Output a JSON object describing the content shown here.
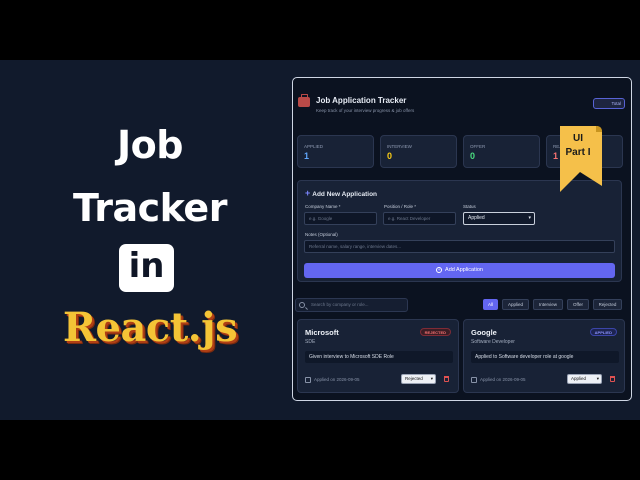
{
  "thumbnail": {
    "line1": "Job",
    "line2": "Tracker",
    "line3": "in",
    "line4": "React.js"
  },
  "ribbon": {
    "line1": "UI",
    "line2": "Part I"
  },
  "app": {
    "title": "Job Application Tracker",
    "subtitle": "Keep track of your interview progress & job offers",
    "total_label": "Total",
    "stats": [
      {
        "label": "APPLIED",
        "value": "1",
        "color": "#60a5fa"
      },
      {
        "label": "INTERVIEW",
        "value": "0",
        "color": "#facc15"
      },
      {
        "label": "OFFER",
        "value": "0",
        "color": "#4ade80"
      },
      {
        "label": "REJECTED",
        "value": "1",
        "color": "#f87171"
      }
    ],
    "form": {
      "heading": "Add New Application",
      "company_label": "Company Name *",
      "company_placeholder": "e.g. Google",
      "position_label": "Position / Role *",
      "position_placeholder": "e.g. React Developer",
      "status_label": "Status",
      "status_value": "Applied",
      "notes_label": "Notes (Optional)",
      "notes_placeholder": "Referral name, salary range, interview dates...",
      "add_button": "Add Application"
    },
    "search_placeholder": "Search by company or role...",
    "filters": [
      "All",
      "Applied",
      "Interview",
      "Offer",
      "Rejected"
    ],
    "jobs": [
      {
        "company": "Microsoft",
        "role": "SDE",
        "badge": "REJECTED",
        "note": "Given interview to Microsoft SDE Role",
        "date": "Applied on 2026-09-05",
        "status": "Rejected"
      },
      {
        "company": "Google",
        "role": "Software Developer",
        "badge": "APPLIED",
        "note": "Applied to Software developer role at google",
        "date": "Applied on 2026-09-05",
        "status": "Applied"
      }
    ]
  },
  "colors": {
    "accent": "#6366f1",
    "background": "#111a2c",
    "react_yellow": "#f4c436",
    "ribbon_gold": "#f5c04a"
  }
}
